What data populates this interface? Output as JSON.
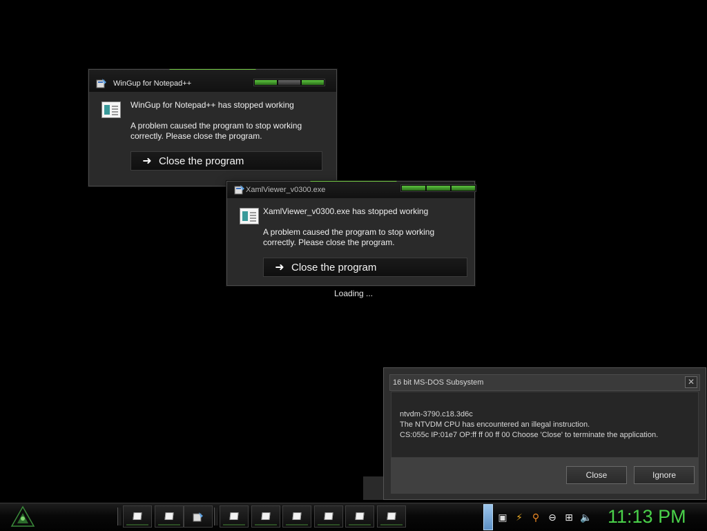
{
  "dialogs": [
    {
      "title": "WinGup for Notepad++",
      "headline": "WinGup for Notepad++ has stopped working",
      "description": "A problem caused the program to stop working correctly. Please close the program.",
      "button_label": "Close the program"
    },
    {
      "title": "XamlViewer_v0300.exe",
      "headline": "XamlViewer_v0300.exe has stopped working",
      "description": "A problem caused the program to stop working correctly. Please close the program.",
      "button_label": "Close the program"
    }
  ],
  "loading_text": "Loading ...",
  "dos_dialog": {
    "title": "16 bit MS-DOS Subsystem",
    "close_glyph": "✕",
    "lines": [
      "ntvdm-3790.c18.3d6c",
      "The NTVDM CPU has encountered an illegal instruction.",
      "CS:055c IP:01e7 OP:ff ff 00 ff 00 Choose 'Close' to terminate the application."
    ],
    "close_label": "Close",
    "ignore_label": "Ignore"
  },
  "taskbar": {
    "clock": "11:13 PM",
    "accent_color": "#4ad14a",
    "tray_icons": [
      "network-drive-icon",
      "bolt-icon",
      "search-icon",
      "minus-circle-icon",
      "network-icon",
      "volume-icon"
    ]
  }
}
